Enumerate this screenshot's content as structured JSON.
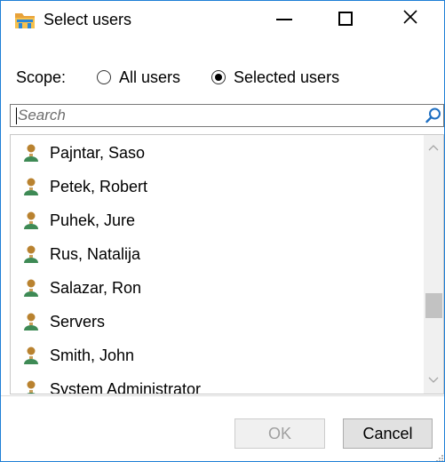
{
  "window": {
    "title": "Select users",
    "border_color": "#1e7fd6"
  },
  "titlebar": {
    "icons": {
      "app": "folder-icon",
      "minimize": "minimize-icon",
      "maximize": "maximize-icon",
      "close": "close-icon"
    },
    "close_glyph": "✕"
  },
  "scope": {
    "label": "Scope:",
    "options": [
      {
        "label": "All users",
        "selected": false
      },
      {
        "label": "Selected users",
        "selected": true
      }
    ]
  },
  "search": {
    "placeholder": "Search",
    "value": "",
    "icon": "search-icon"
  },
  "list": {
    "item_icon": "user-icon",
    "items": [
      {
        "label": "Pajntar, Saso"
      },
      {
        "label": "Petek, Robert"
      },
      {
        "label": "Puhek, Jure"
      },
      {
        "label": "Rus, Natalija"
      },
      {
        "label": "Salazar, Ron"
      },
      {
        "label": "Servers"
      },
      {
        "label": "Smith, John"
      },
      {
        "label": "System Administrator"
      }
    ],
    "scroll_position": 0.7
  },
  "buttons": {
    "ok_label": "OK",
    "ok_enabled": false,
    "cancel_label": "Cancel"
  },
  "colors": {
    "accent": "#0078d7",
    "disabled_text": "#a0a0a0"
  }
}
